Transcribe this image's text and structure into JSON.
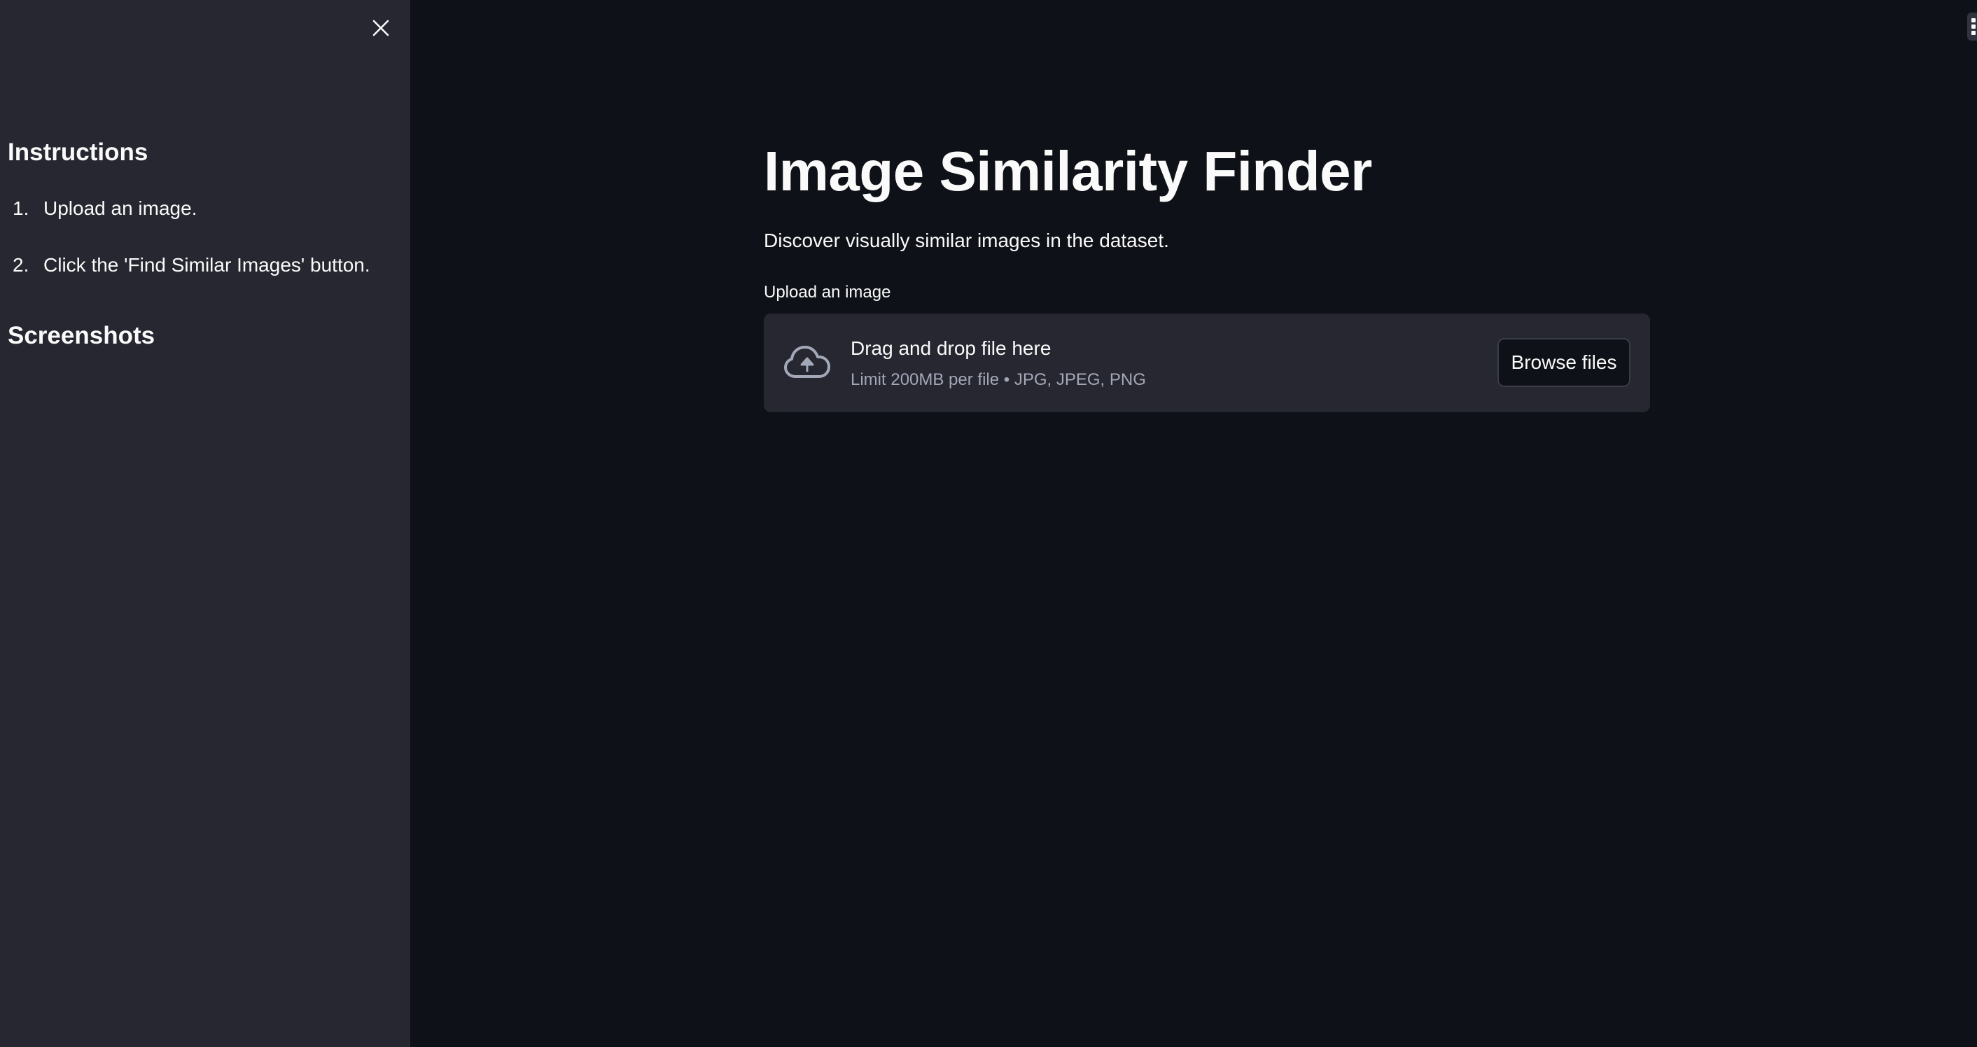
{
  "sidebar": {
    "close_icon": "close-icon",
    "instructions_heading": "Instructions",
    "instructions": [
      {
        "num": "1.",
        "text": "Upload an image."
      },
      {
        "num": "2.",
        "text": "Click the 'Find Similar Images' button."
      }
    ],
    "screenshots_heading": "Screenshots"
  },
  "main": {
    "title": "Image Similarity Finder",
    "subtitle": "Discover visually similar images in the dataset.",
    "uploader": {
      "label": "Upload an image",
      "icon": "cloud-upload-icon",
      "drop_text": "Drag and drop file here",
      "limit_text": "Limit 200MB per file • JPG, JPEG, PNG",
      "browse_label": "Browse files"
    }
  },
  "header": {
    "menu_icon": "main-menu-icon"
  },
  "colors": {
    "background": "#0e1117",
    "sidebar": "#262730",
    "text": "#fafafa",
    "muted_text": "#a3a8b8"
  }
}
